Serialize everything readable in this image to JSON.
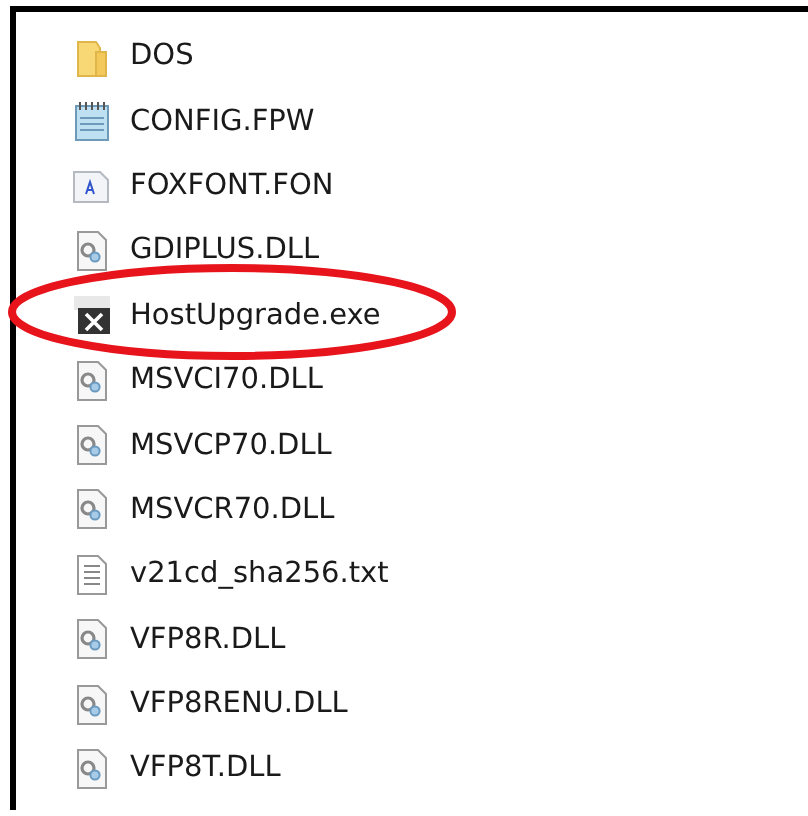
{
  "files": [
    {
      "name": "DOS",
      "kind": "folder",
      "highlighted": false
    },
    {
      "name": "CONFIG.FPW",
      "kind": "notepad",
      "highlighted": false
    },
    {
      "name": "FOXFONT.FON",
      "kind": "font",
      "highlighted": false
    },
    {
      "name": "GDIPLUS.DLL",
      "kind": "dll",
      "highlighted": false
    },
    {
      "name": "HostUpgrade.exe",
      "kind": "exe",
      "highlighted": true
    },
    {
      "name": "MSVCI70.DLL",
      "kind": "dll",
      "highlighted": false
    },
    {
      "name": "MSVCP70.DLL",
      "kind": "dll",
      "highlighted": false
    },
    {
      "name": "MSVCR70.DLL",
      "kind": "dll",
      "highlighted": false
    },
    {
      "name": "v21cd_sha256.txt",
      "kind": "text",
      "highlighted": false
    },
    {
      "name": "VFP8R.DLL",
      "kind": "dll",
      "highlighted": false
    },
    {
      "name": "VFP8RENU.DLL",
      "kind": "dll",
      "highlighted": false
    },
    {
      "name": "VFP8T.DLL",
      "kind": "dll",
      "highlighted": false
    }
  ]
}
